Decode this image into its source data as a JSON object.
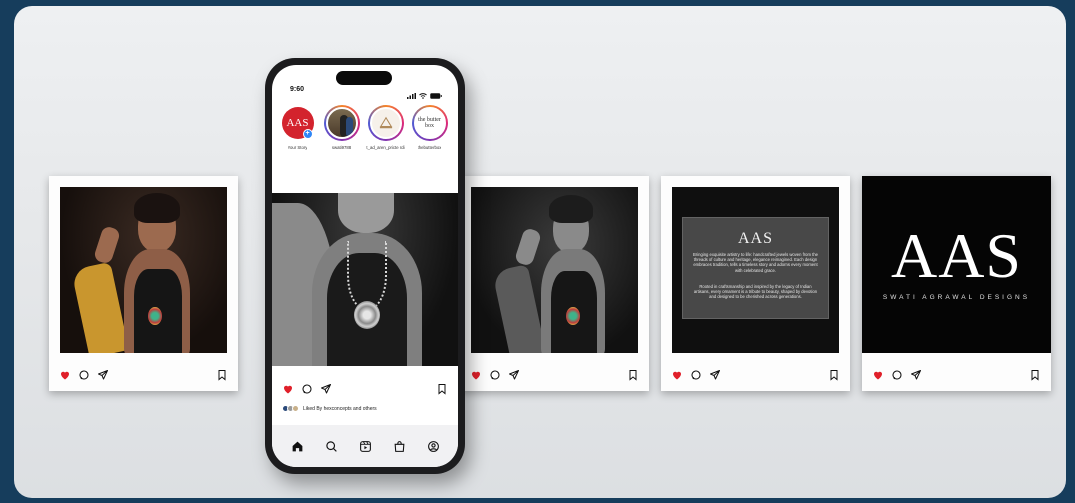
{
  "colors": {
    "background": "#163d5c",
    "heart": "#e0202a",
    "brand_red": "#d3232d"
  },
  "phone": {
    "status": {
      "time": "9:60"
    },
    "stories": [
      {
        "label": "Your Story",
        "kind": "aas-logo",
        "avatar_text": "AAS"
      },
      {
        "label": "swati9788",
        "kind": "photo"
      },
      {
        "label": "t_ad_aren_pricte rdi",
        "kind": "logo"
      },
      {
        "label": "thebutterbox",
        "kind": "butter",
        "avatar_text": "the butter box"
      }
    ],
    "post": {
      "liked_text": "Liked By hexconcepts and others"
    },
    "tabbar": [
      "home-icon",
      "search-icon",
      "reels-icon",
      "shop-icon",
      "profile-icon"
    ]
  },
  "feed_cards": [
    {
      "kind": "portrait-color"
    },
    {
      "kind": "portrait-bw"
    },
    {
      "kind": "text-slide",
      "brand": "AAS",
      "paragraph_1": "Bringing exquisite artistry to life: handcrafted jewels woven from the threads of culture and heritage, elegance reimagined. Each design embraces tradition, tells a timeless story and adorns every moment with celebrated grace.",
      "paragraph_2": "Rooted in craftsmanship and inspired by the legacy of Indian artisans, every ornament is a tribute to beauty, shaped by devotion and designed to be cherished across generations."
    },
    {
      "kind": "logo-slide",
      "brand": "AAS",
      "tagline": "SWATI AGRAWAL DESIGNS"
    }
  ]
}
